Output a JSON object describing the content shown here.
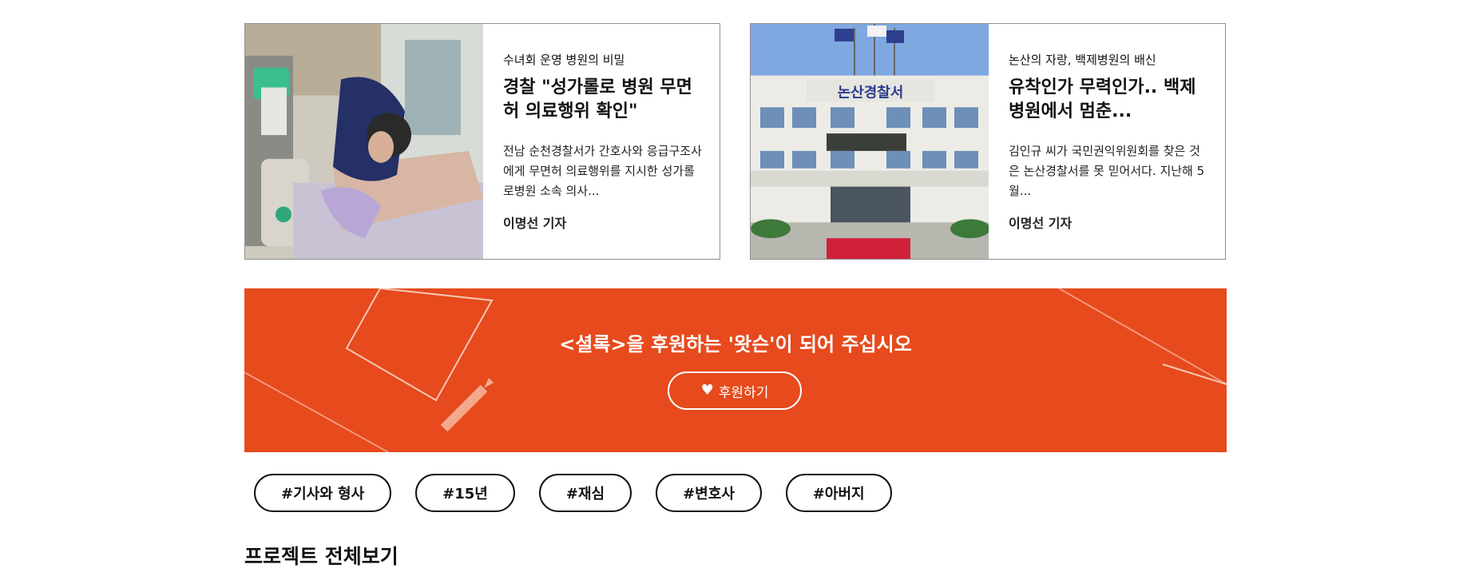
{
  "articles": [
    {
      "kicker": "수녀회 운영 병원의 비밀",
      "headline": "경찰 \"성가롤로 병원 무면허 의료행위 확인\"",
      "excerpt": "전남 순천경찰서가 간호사와 응급구조사에게 무면허 의료행위를 지시한 성가롤로병원 소속 의사...",
      "byline": "이명선 기자"
    },
    {
      "kicker": "논산의 자랑, 백제병원의 배신",
      "headline": "유착인가 무력인가.. 백제병원에서 멈춘...",
      "excerpt": "김인규 씨가 국민권익위원회를 찾은 것은 논산경찰서를 못 믿어서다. 지난해 5월...",
      "byline": "이명선 기자"
    }
  ],
  "banner": {
    "title": "<셜록>을 후원하는 '왓슨'이 되어 주십시오",
    "button_label": "후원하기",
    "button_icon": "heart-icon",
    "background_color": "#e64a1d"
  },
  "tags": [
    "#기사와 형사",
    "#15년",
    "#재심",
    "#변호사",
    "#아버지"
  ],
  "section_title": "프로젝트 전체보기"
}
